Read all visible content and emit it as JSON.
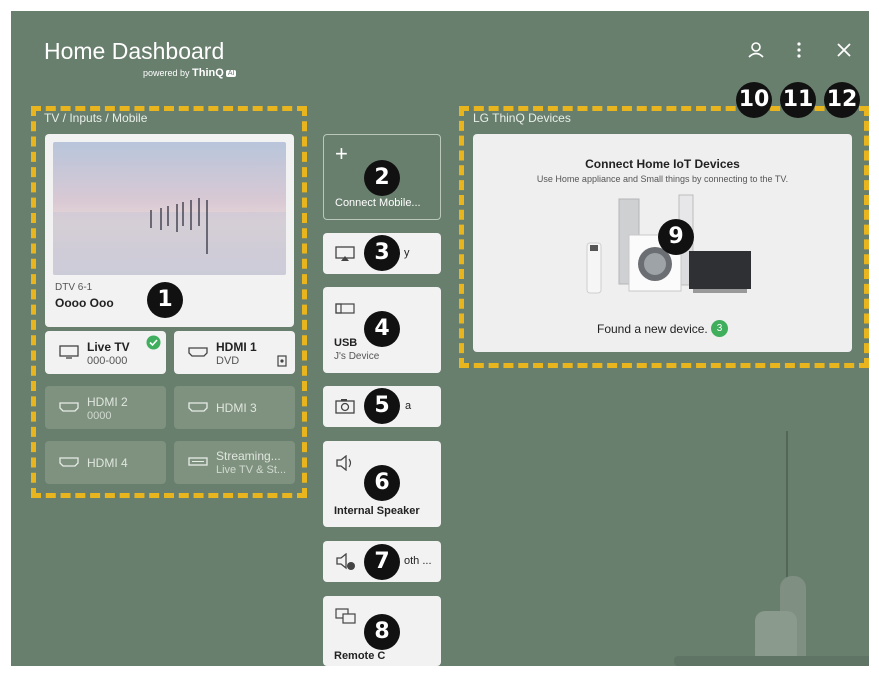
{
  "header": {
    "title": "Home Dashboard",
    "powered_by": "powered by",
    "brand": "ThinQ",
    "brand_badge": "AI"
  },
  "top_icons": [
    "user-icon",
    "more-vert-icon",
    "close-icon"
  ],
  "tv_section": {
    "label": "TV / Inputs / Mobile",
    "preview": {
      "channel": "DTV 6-1",
      "program": "Oooo Ooo"
    },
    "inputs": [
      {
        "name": "Live TV",
        "sub": "000-000",
        "active": true
      },
      {
        "name": "HDMI 1",
        "sub": "DVD",
        "active": true
      },
      {
        "name": "HDMI 2",
        "sub": "0000",
        "active": false
      },
      {
        "name": "HDMI 3",
        "sub": "",
        "active": false
      },
      {
        "name": "HDMI 4",
        "sub": "",
        "active": false
      },
      {
        "name": "Streaming...",
        "sub": "Live TV & St...",
        "active": false
      }
    ]
  },
  "middle_column": {
    "connect_mobile": "Connect Mobile...",
    "airplay": "y",
    "usb": {
      "name": "USB",
      "sub": "J's Device"
    },
    "camera": "a",
    "speaker": "Internal Speaker",
    "bluetooth": "oth ...",
    "remote_pc": "Remote C"
  },
  "thinq_section": {
    "label": "LG ThinQ Devices",
    "heading": "Connect Home IoT Devices",
    "subtext": "Use Home appliance and Small things by connecting to the TV.",
    "found": "Found a new device.",
    "found_count": "3"
  },
  "badges": [
    "1",
    "2",
    "3",
    "4",
    "5",
    "6",
    "7",
    "8",
    "9",
    "10",
    "11",
    "12"
  ],
  "colors": {
    "background": "#697f6e",
    "dash": "#e8b51e",
    "check": "#3fae5d"
  }
}
